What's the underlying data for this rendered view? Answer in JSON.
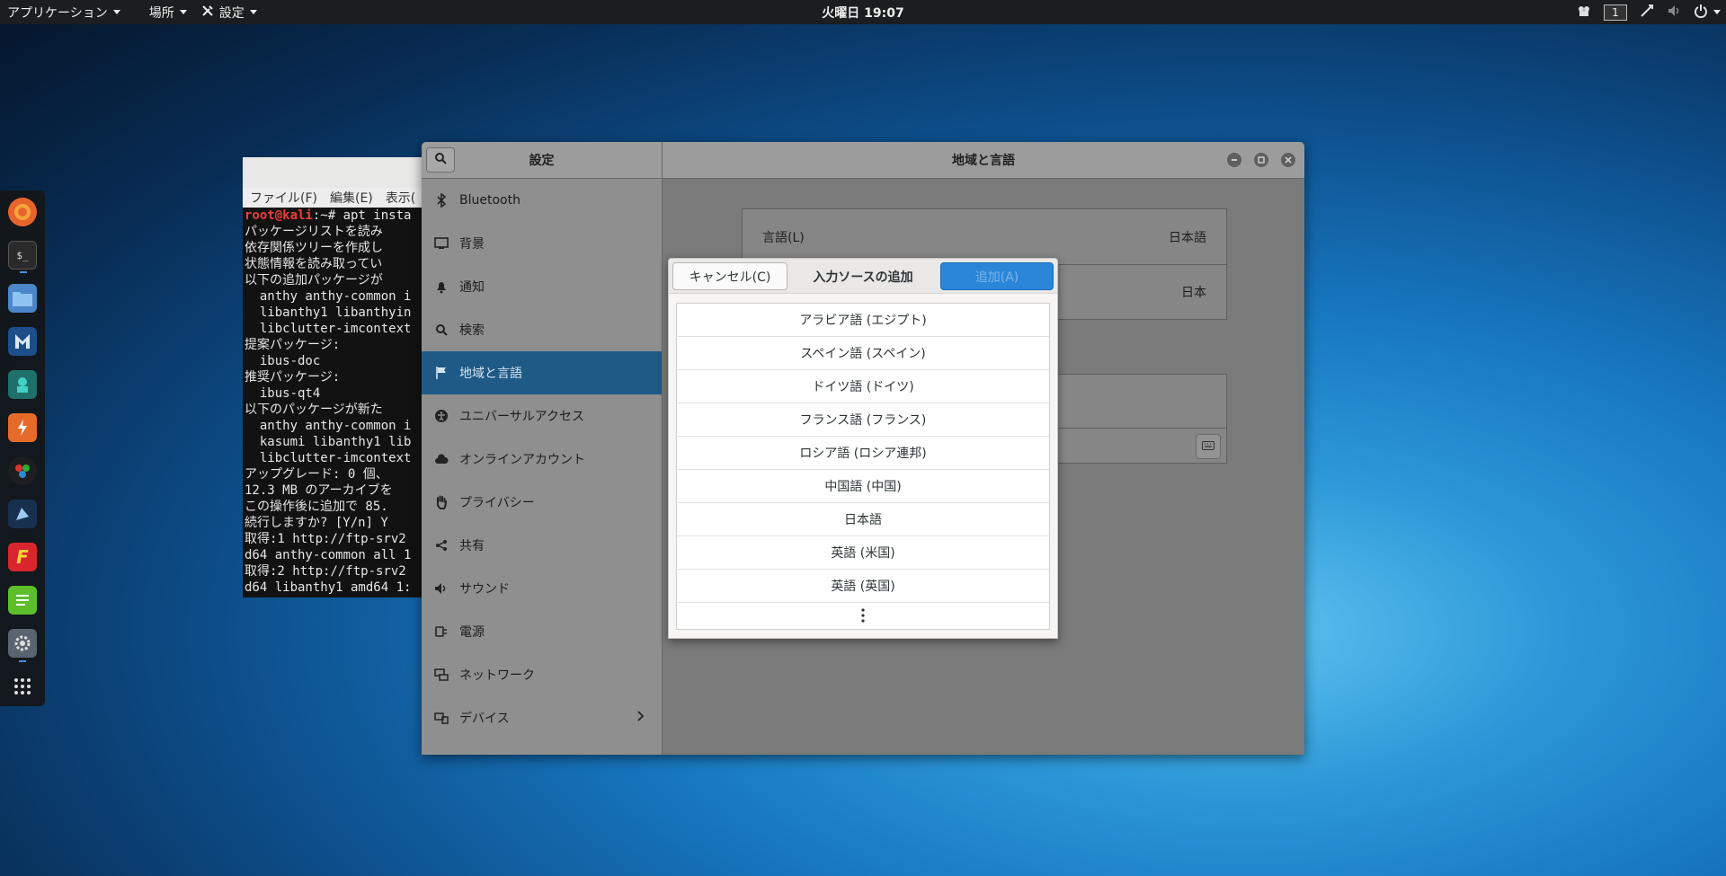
{
  "topbar": {
    "apps_label": "アプリケーション",
    "places_label": "場所",
    "settings_label": "設定",
    "clock": "火曜日 19:07",
    "workspace": "1"
  },
  "dock": {
    "items": [
      "firefox-icon",
      "terminal-icon",
      "files-icon",
      "metasploit-icon",
      "maltego-icon",
      "burpsuite-icon",
      "armitage-icon",
      "beef-icon",
      "faraday-icon",
      "notes-icon",
      "settings-app-icon",
      "show-apps-icon"
    ]
  },
  "terminal": {
    "menu": [
      "ファイル(F)",
      "編集(E)",
      "表示("
    ],
    "prompt_user": "root@kali",
    "prompt_rest": ":~# apt insta",
    "lines": [
      "パッケージリストを読み",
      "依存関係ツリーを作成し",
      "状態情報を読み取ってい",
      "以下の追加パッケージが",
      "  anthy anthy-common i",
      "  libanthy1 libanthyin",
      "  libclutter-imcontext",
      "提案パッケージ:",
      "  ibus-doc",
      "推奨パッケージ:",
      "  ibus-qt4",
      "以下のパッケージが新た",
      "  anthy anthy-common i",
      "  kasumi libanthy1 lib",
      "  libclutter-imcontext",
      "アップグレード: 0 個、",
      "12.3 MB のアーカイブを",
      "この操作後に追加で 85.",
      "続行しますか? [Y/n] Y",
      "取得:1 http://ftp-srv2",
      "d64 anthy-common all 1",
      "取得:2 http://ftp-srv2",
      "d64 libanthy1 amd64 1:"
    ]
  },
  "settings": {
    "sidebar_title": "設定",
    "panel_title": "地域と言語",
    "sidebar_items": [
      {
        "label": "Bluetooth",
        "icon": "bluetooth-icon",
        "active": false
      },
      {
        "label": "背景",
        "icon": "background-icon",
        "active": false
      },
      {
        "label": "通知",
        "icon": "bell-icon",
        "active": false
      },
      {
        "label": "検索",
        "icon": "search-icon",
        "active": false
      },
      {
        "label": "地域と言語",
        "icon": "flag-icon",
        "active": true
      },
      {
        "label": "ユニバーサルアクセス",
        "icon": "accessibility-icon",
        "active": false
      },
      {
        "label": "オンラインアカウント",
        "icon": "cloud-icon",
        "active": false
      },
      {
        "label": "プライバシー",
        "icon": "hand-icon",
        "active": false
      },
      {
        "label": "共有",
        "icon": "share-icon",
        "active": false
      },
      {
        "label": "サウンド",
        "icon": "speaker-icon",
        "active": false
      },
      {
        "label": "電源",
        "icon": "power-plug-icon",
        "active": false
      },
      {
        "label": "ネットワーク",
        "icon": "network-icon",
        "active": false
      },
      {
        "label": "デバイス",
        "icon": "devices-icon",
        "active": false
      }
    ],
    "language_label": "言語(L)",
    "language_value": "日本語",
    "formats_value": "日本"
  },
  "dialog": {
    "cancel_label": "キャンセル(C)",
    "title": "入力ソースの追加",
    "add_label": "追加(A)",
    "languages": [
      "アラビア語 (エジプト)",
      "スペイン語 (スペイン)",
      "ドイツ語 (ドイツ)",
      "フランス語 (フランス)",
      "ロシア語 (ロシア連邦)",
      "中国語 (中国)",
      "日本語",
      "英語 (米国)",
      "英語 (英国)"
    ]
  },
  "colors": {
    "accent": "#2a86d8",
    "sidebar_active": "#1f5a86",
    "terminal_prompt": "#ef3b3b"
  }
}
